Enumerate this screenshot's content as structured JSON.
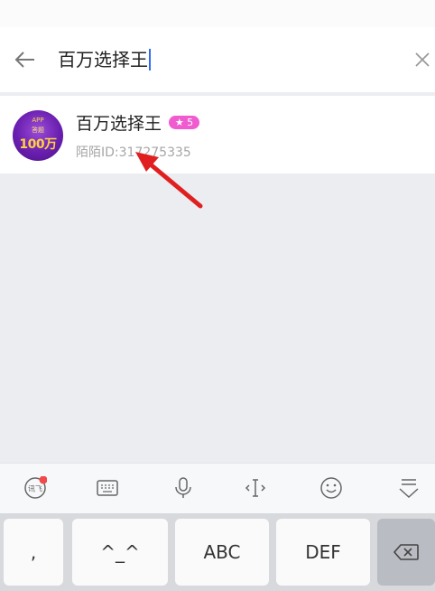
{
  "search": {
    "query": "百万选择王",
    "back_icon": "back-arrow-icon",
    "clear_icon": "close-icon"
  },
  "result": {
    "name": "百万选择王",
    "level_badge": "★ 5",
    "id_text": "陌陌ID:317275335",
    "avatar_lines": [
      "APP",
      "答题",
      "100万"
    ]
  },
  "toolbar": {
    "icons": [
      "voice-input-icon",
      "keyboard-icon",
      "microphone-icon",
      "cursor-move-icon",
      "emoji-icon",
      "hide-keyboard-icon"
    ]
  },
  "keyboard": {
    "keys": [
      ",",
      "^_^",
      "ABC",
      "DEF",
      "backspace"
    ]
  },
  "colors": {
    "accent_cursor": "#2f6cf3",
    "badge": "#f05bd0",
    "annotation_arrow": "#e02020",
    "notification_dot": "#f04a4a"
  }
}
